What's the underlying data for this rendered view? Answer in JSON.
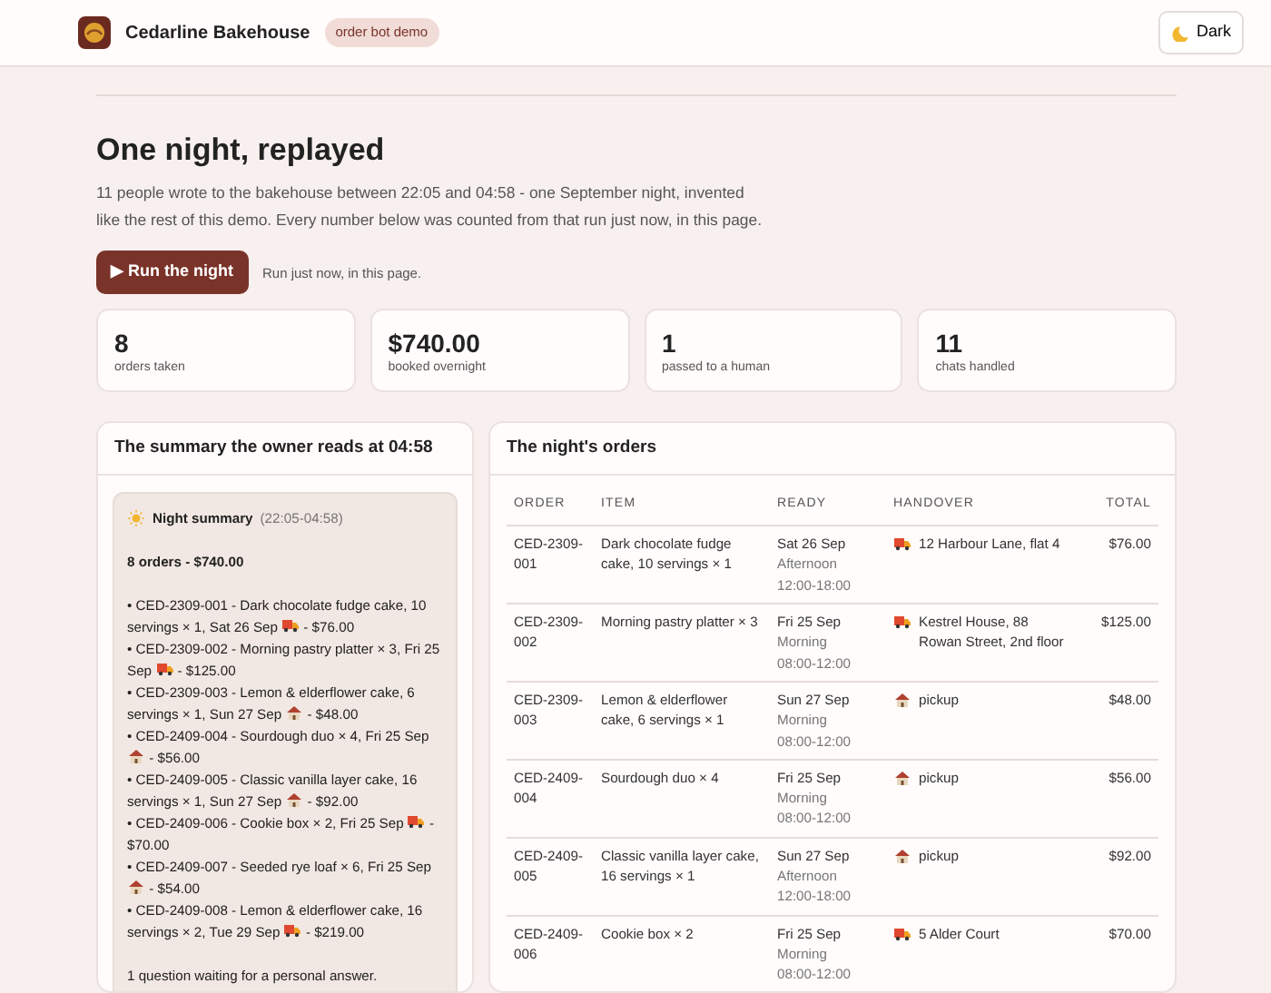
{
  "header": {
    "brand": "Cedarline Bakehouse",
    "badge": "order bot demo",
    "theme_button": "Dark"
  },
  "intro": {
    "title": "One night, replayed",
    "text": "11 people wrote to the bakehouse between 22:05 and 04:58 - one September night, invented like the rest of this demo. Every number below was counted from that run just now, in this page.",
    "run_button": "▶ Run the night",
    "run_note": "Run just now, in this page."
  },
  "stats": [
    {
      "value": "8",
      "label": "orders taken"
    },
    {
      "value": "$740.00",
      "label": "booked overnight"
    },
    {
      "value": "1",
      "label": "passed to a human"
    },
    {
      "value": "11",
      "label": "chats handled"
    }
  ],
  "summary": {
    "title": "The summary the owner reads at 04:58",
    "heading": "Night summary",
    "time": "(22:05-04:58)",
    "total": "8 orders - $740.00",
    "lines": [
      {
        "before": "• CED-2309-001 - Dark chocolate fudge cake, 10 servings × 1, Sat 26 Sep",
        "kind": "delivery",
        "after": "- $76.00"
      },
      {
        "before": "• CED-2309-002 - Morning pastry platter × 3, Fri 25 Sep",
        "kind": "delivery",
        "after": "- $125.00"
      },
      {
        "before": "• CED-2309-003 - Lemon & elderflower cake, 6 servings × 1, Sun 27 Sep",
        "kind": "pickup",
        "after": "- $48.00"
      },
      {
        "before": "• CED-2409-004 - Sourdough duo × 4, Fri 25 Sep",
        "kind": "pickup",
        "after": "- $56.00"
      },
      {
        "before": "• CED-2409-005 - Classic vanilla layer cake, 16 servings × 1, Sun 27 Sep",
        "kind": "pickup",
        "after": "- $92.00"
      },
      {
        "before": "• CED-2409-006 - Cookie box × 2, Fri 25 Sep",
        "kind": "delivery",
        "after": "- $70.00"
      },
      {
        "before": "• CED-2409-007 - Seeded rye loaf × 6, Fri 25 Sep",
        "kind": "pickup",
        "after": "- $54.00"
      },
      {
        "before": "• CED-2409-008 - Lemon & elderflower cake, 16 servings × 2, Tue 29 Sep",
        "kind": "delivery",
        "after": "- $219.00"
      }
    ],
    "footer": "1 question waiting for a personal answer."
  },
  "orders": {
    "title": "The night's orders",
    "columns": [
      "ORDER",
      "ITEM",
      "READY",
      "HANDOVER",
      "TOTAL"
    ],
    "rows": [
      {
        "order": "CED-2309-001",
        "item": "Dark chocolate fudge cake, 10 servings × 1",
        "date": "Sat 26 Sep",
        "slot": "Afternoon",
        "hours": "12:00-18:00",
        "kind": "delivery",
        "place": "12 Harbour Lane, flat 4",
        "total": "$76.00"
      },
      {
        "order": "CED-2309-002",
        "item": "Morning pastry platter × 3",
        "date": "Fri 25 Sep",
        "slot": "Morning",
        "hours": "08:00-12:00",
        "kind": "delivery",
        "place": "Kestrel House, 88 Rowan Street, 2nd floor",
        "total": "$125.00"
      },
      {
        "order": "CED-2309-003",
        "item": "Lemon & elderflower cake, 6 servings × 1",
        "date": "Sun 27 Sep",
        "slot": "Morning",
        "hours": "08:00-12:00",
        "kind": "pickup",
        "place": "pickup",
        "total": "$48.00"
      },
      {
        "order": "CED-2409-004",
        "item": "Sourdough duo × 4",
        "date": "Fri 25 Sep",
        "slot": "Morning",
        "hours": "08:00-12:00",
        "kind": "pickup",
        "place": "pickup",
        "total": "$56.00"
      },
      {
        "order": "CED-2409-005",
        "item": "Classic vanilla layer cake, 16 servings × 1",
        "date": "Sun 27 Sep",
        "slot": "Afternoon",
        "hours": "12:00-18:00",
        "kind": "pickup",
        "place": "pickup",
        "total": "$92.00"
      },
      {
        "order": "CED-2409-006",
        "item": "Cookie box × 2",
        "date": "Fri 25 Sep",
        "slot": "Morning",
        "hours": "08:00-12:00",
        "kind": "delivery",
        "place": "5 Alder Court",
        "total": "$70.00"
      }
    ]
  }
}
